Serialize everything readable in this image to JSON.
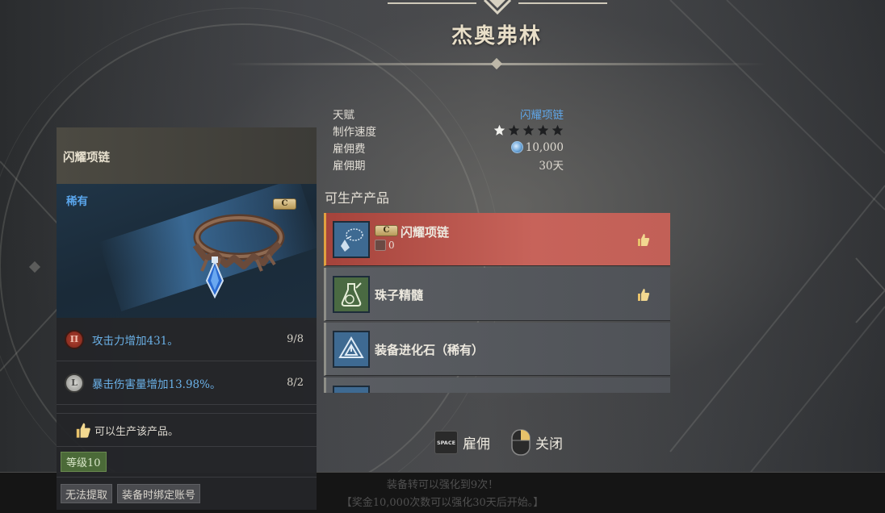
{
  "npc": {
    "name": "杰奥弗林"
  },
  "info": {
    "talent_label": "天赋",
    "talent_value": "闪耀项链",
    "speed_label": "制作速度",
    "speed_stars_filled": 1,
    "speed_stars_total": 5,
    "fee_label": "雇佣费",
    "fee_value": "10,000",
    "period_label": "雇佣期",
    "period_value": "30天"
  },
  "products": {
    "title": "可生产产品",
    "items": [
      {
        "name": "闪耀项链",
        "grade": "C",
        "count": "0",
        "selected": true,
        "recommended": true,
        "icon": "necklace-icon"
      },
      {
        "name": "珠子精髓",
        "selected": false,
        "recommended": true,
        "icon": "potion-flask-icon"
      },
      {
        "name": "装备进化石（稀有）",
        "selected": false,
        "recommended": false,
        "icon": "evolution-stone-icon"
      }
    ]
  },
  "item_card": {
    "name": "闪耀项链",
    "rarity": "稀有",
    "grade": "C",
    "stats": [
      {
        "text": "攻击力增加431。",
        "count": "9/8",
        "icon": "attack-rune-icon"
      },
      {
        "text": "暴击伤害量增加13.98%。",
        "count": "8/2",
        "icon": "crit-rune-icon"
      }
    ],
    "note": "可以生产该产品。",
    "level": "等级10",
    "tags": [
      "无法提取",
      "装备时绑定账号"
    ]
  },
  "keys": {
    "space_key": "SPACE",
    "hire_label": "雇佣",
    "close_label": "关闭"
  },
  "bottom_ghost": {
    "line1": "装备转可以强化到9次！",
    "line2": "【奖金10,000次数可以强化30天后开始。】"
  },
  "colors": {
    "accent_blue": "#5fa6e8",
    "selected_red": "#c7635a",
    "level_green": "#4b6a38"
  }
}
